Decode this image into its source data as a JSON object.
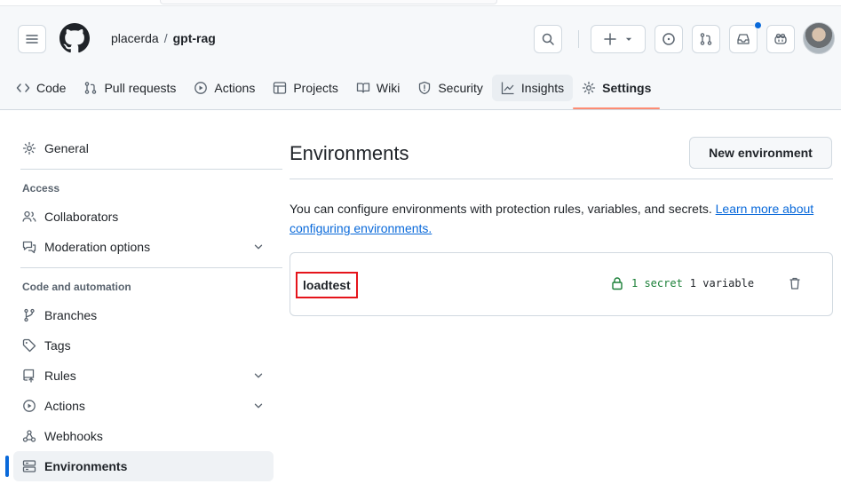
{
  "header": {
    "owner": "placerda",
    "separator": "/",
    "repo": "gpt-rag"
  },
  "repo_nav": {
    "tabs": [
      {
        "label": "Code",
        "icon": "code-icon"
      },
      {
        "label": "Pull requests",
        "icon": "git-pull-request-icon"
      },
      {
        "label": "Actions",
        "icon": "play-icon"
      },
      {
        "label": "Projects",
        "icon": "table-icon"
      },
      {
        "label": "Wiki",
        "icon": "book-icon"
      },
      {
        "label": "Security",
        "icon": "shield-icon"
      },
      {
        "label": "Insights",
        "icon": "graph-icon"
      },
      {
        "label": "Settings",
        "icon": "gear-icon"
      }
    ],
    "selected": "Settings"
  },
  "sidebar": {
    "general": "General",
    "access_heading": "Access",
    "collaborators": "Collaborators",
    "moderation": "Moderation options",
    "code_heading": "Code and automation",
    "branches": "Branches",
    "tags": "Tags",
    "rules": "Rules",
    "actions": "Actions",
    "webhooks": "Webhooks",
    "environments": "Environments"
  },
  "main": {
    "title": "Environments",
    "new_button": "New environment",
    "description": "You can configure environments with protection rules, variables, and secrets.",
    "learn_more": "Learn more about configuring environments.",
    "environments": [
      {
        "name": "loadtest",
        "secrets": "1 secret",
        "variables": "1 variable"
      }
    ]
  },
  "colors": {
    "accent": "#0969da",
    "selected_tab_underline": "#fd8c73",
    "success": "#1a7f37",
    "highlight_box": "#e5141b"
  }
}
